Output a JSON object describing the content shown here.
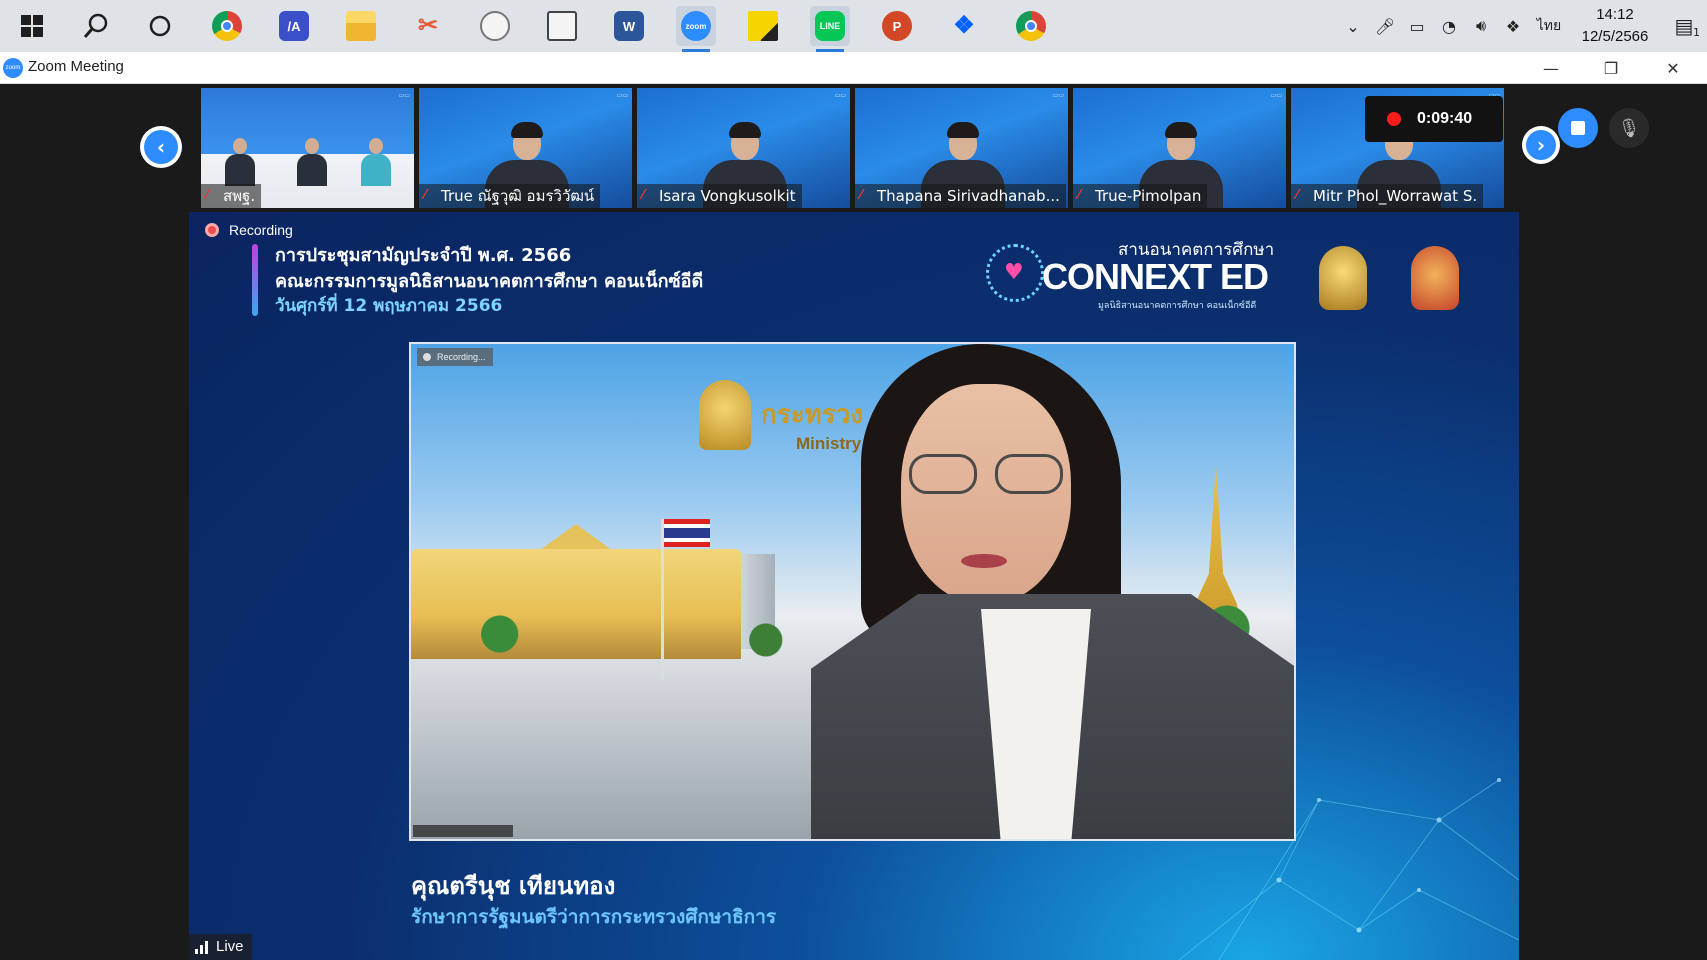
{
  "taskbar": {
    "apps": [
      {
        "name": "start",
        "icon": "windows-logo-icon",
        "label": "",
        "color": "#1f1f1f"
      },
      {
        "name": "search",
        "icon": "search-icon",
        "label": "",
        "color": "#1f1f1f"
      },
      {
        "name": "task-view",
        "icon": "cortana-icon",
        "label": "",
        "color": "#1f1f1f"
      },
      {
        "name": "chrome",
        "icon": "chrome-icon",
        "label": "",
        "color": "#dd4b3e"
      },
      {
        "name": "app-ai",
        "icon": "ai-app-icon",
        "label": "/A",
        "color": "#3b4fc9"
      },
      {
        "name": "file-explorer",
        "icon": "folder-icon",
        "label": "",
        "color": "#f2b533"
      },
      {
        "name": "snipping",
        "icon": "scissors-icon",
        "label": "",
        "color": "#e65a3a"
      },
      {
        "name": "alarms",
        "icon": "clock-icon",
        "label": "",
        "color": "#777777"
      },
      {
        "name": "calculator",
        "icon": "calculator-icon",
        "label": "",
        "color": "#444444"
      },
      {
        "name": "word",
        "icon": "word-icon",
        "label": "W",
        "color": "#2b579a"
      },
      {
        "name": "zoom",
        "icon": "zoom-icon",
        "label": "zoom",
        "color": "#2d8cff"
      },
      {
        "name": "sticky-notes",
        "icon": "sticky-note-icon",
        "label": "",
        "color": "#f5d400"
      },
      {
        "name": "line",
        "icon": "line-icon",
        "label": "LINE",
        "color": "#06c755"
      },
      {
        "name": "powerpoint",
        "icon": "powerpoint-icon",
        "label": "P",
        "color": "#d24726"
      },
      {
        "name": "dropbox",
        "icon": "dropbox-icon",
        "label": "",
        "color": "#0061ff"
      },
      {
        "name": "chrome-profile",
        "icon": "chrome-profile-icon",
        "label": "",
        "color": "#dd4b3e"
      }
    ],
    "tray": {
      "language": "ไทย",
      "time": "14:12",
      "date": "12/5/2566",
      "notifications": "1"
    }
  },
  "window": {
    "title": "Zoom Meeting"
  },
  "meeting": {
    "participants": [
      {
        "name": "สพฐ.",
        "kind": "studio"
      },
      {
        "name": "True ณัฐวุฒิ อมรวิวัฒน์",
        "kind": "person"
      },
      {
        "name": "Isara Vongkusolkit",
        "kind": "person"
      },
      {
        "name": "Thapana Sirivadhanab...",
        "kind": "person"
      },
      {
        "name": "True-Pimolpan",
        "kind": "person"
      },
      {
        "name": "Mitr Phol_Worrawat S.",
        "kind": "person"
      }
    ],
    "recording_time": "0:09:40",
    "recording_label": "Recording",
    "live_label": "Live"
  },
  "slide": {
    "line1": "การประชุมสามัญประจำปี พ.ศ. 2566",
    "line2": "คณะกรรมการมูลนิธิสานอนาคตการศึกษา คอนเน็กซ์อีดี",
    "line3": "วันศุกร์ที่ 12 พฤษภาคม 2566",
    "brand_thai": "สานอนาคตการศึกษา",
    "brand_main": "CONNEXT",
    "brand_ed": "ED",
    "brand_small": "มูลนิธิสานอนาคตการศึกษา คอนเน็กซ์อีดี",
    "ministry_th": "กระทรวง",
    "ministry_en": "Ministry",
    "video_rec_badge": "Recording...",
    "speaker_name": "คุณตรีนุช เทียนทอง",
    "speaker_role": "รักษาการรัฐมนตรีว่าการกระทรวงศึกษาธิการ"
  }
}
